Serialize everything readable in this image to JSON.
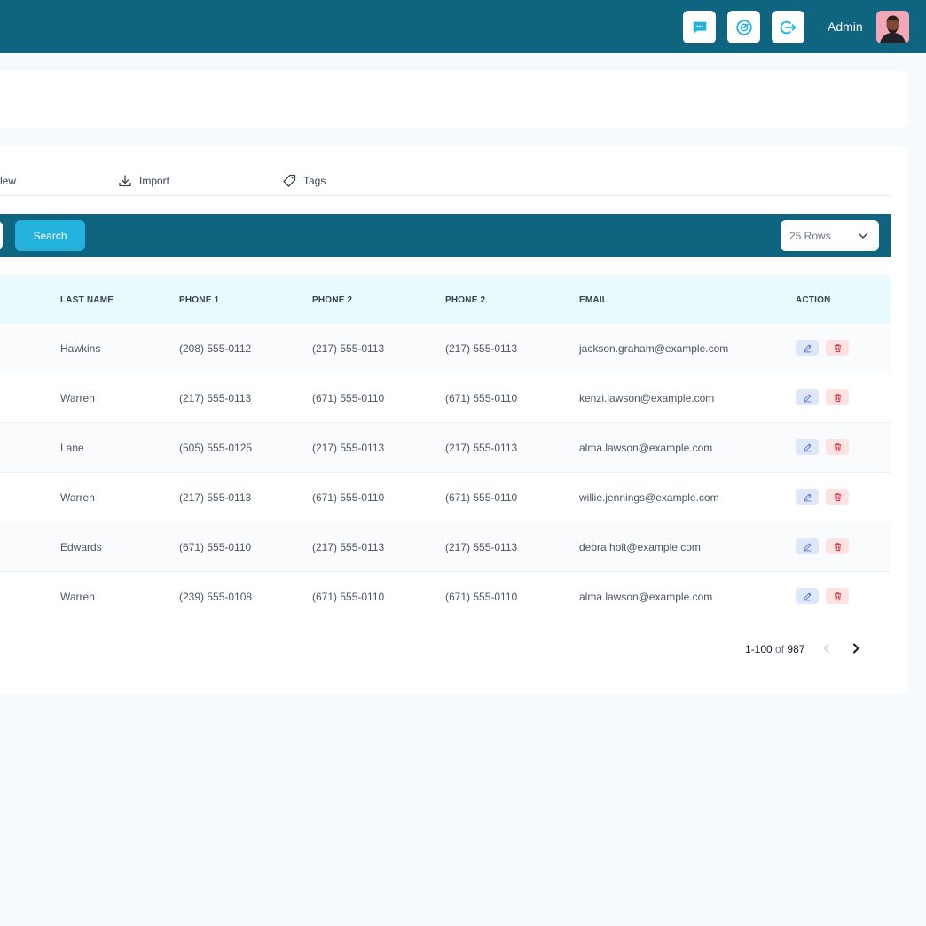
{
  "header": {
    "user_name": "Admin",
    "icons": [
      "chat-icon",
      "dashboard-gauge-icon",
      "logout-icon"
    ],
    "bar_color": "#0f6480",
    "accent_color": "#23b2db"
  },
  "toolbar": {
    "tabs": [
      {
        "label": "New",
        "visible_label": "lew",
        "icon": "plus-icon"
      },
      {
        "label": "Import",
        "icon": "download-icon"
      },
      {
        "label": "Tags",
        "icon": "tag-icon"
      }
    ]
  },
  "search": {
    "button_label": "Search",
    "rows_selected": "25 Rows"
  },
  "table": {
    "columns": [
      "LAST NAME",
      "PHONE 1",
      "PHONE 2",
      "PHONE 2",
      "EMAIL",
      "ACTION"
    ],
    "rows": [
      {
        "last_name": "Hawkins",
        "phone1": "(208) 555-0112",
        "phone2": "(217) 555-0113",
        "phone3": "(217) 555-0113",
        "email": "jackson.graham@example.com"
      },
      {
        "last_name": "Warren",
        "phone1": "(217) 555-0113",
        "phone2": "(671) 555-0110",
        "phone3": "(671) 555-0110",
        "email": "kenzi.lawson@example.com"
      },
      {
        "last_name": "Lane",
        "phone1": "(505) 555-0125",
        "phone2": "(217) 555-0113",
        "phone3": "(217) 555-0113",
        "email": "alma.lawson@example.com"
      },
      {
        "last_name": "Warren",
        "phone1": "(217) 555-0113",
        "phone2": "(671) 555-0110",
        "phone3": "(671) 555-0110",
        "email": "willie.jennings@example.com"
      },
      {
        "last_name": "Edwards",
        "phone1": "(671) 555-0110",
        "phone2": "(217) 555-0113",
        "phone3": "(217) 555-0113",
        "email": "debra.holt@example.com"
      },
      {
        "last_name": "Warren",
        "phone1": "(239) 555-0108",
        "phone2": "(671) 555-0110",
        "phone3": "(671) 555-0110",
        "email": "alma.lawson@example.com"
      }
    ]
  },
  "pagination": {
    "range": "1-100",
    "of_label": "of",
    "total": "987"
  }
}
